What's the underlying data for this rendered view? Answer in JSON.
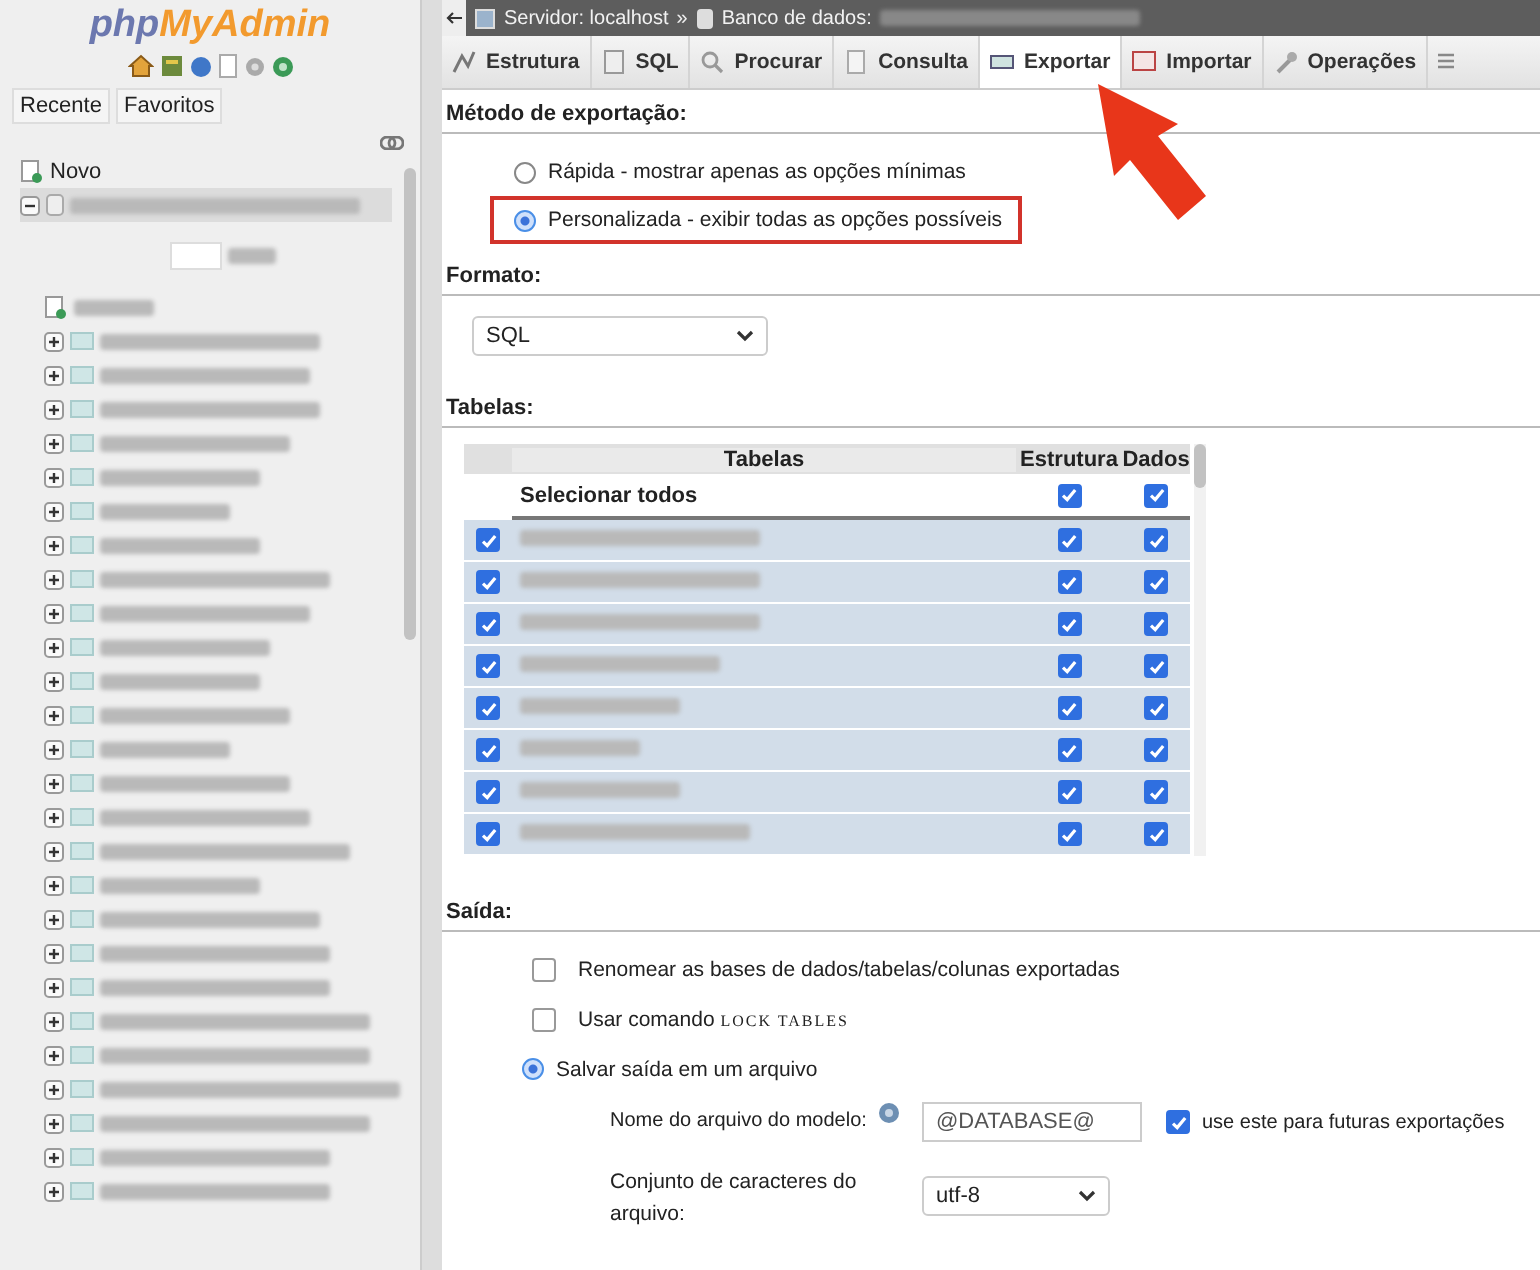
{
  "sidebar": {
    "logo": {
      "prefix": "php",
      "name": "MyAdmin"
    },
    "tabs": [
      {
        "label": "Recente"
      },
      {
        "label": "Favoritos"
      }
    ],
    "tree": [
      {
        "label": "Novo",
        "kind": "new"
      },
      {
        "kind": "database",
        "expanded": true,
        "selected": true,
        "children": [
          {
            "kind": "filter"
          },
          {
            "kind": "new"
          },
          {
            "kind": "table",
            "expanded": false
          },
          {
            "kind": "table",
            "expanded": false
          },
          {
            "kind": "table",
            "expanded": false
          },
          {
            "kind": "table",
            "expanded": false
          },
          {
            "kind": "table",
            "expanded": false
          },
          {
            "kind": "table",
            "expanded": false
          },
          {
            "kind": "table",
            "expanded": false
          },
          {
            "kind": "table",
            "expanded": false
          },
          {
            "kind": "table",
            "expanded": false
          },
          {
            "kind": "table",
            "expanded": false
          },
          {
            "kind": "table",
            "expanded": false
          },
          {
            "kind": "table",
            "expanded": false
          },
          {
            "kind": "table",
            "expanded": false
          },
          {
            "kind": "table",
            "expanded": false
          },
          {
            "kind": "table",
            "expanded": false
          },
          {
            "kind": "table",
            "expanded": false
          },
          {
            "kind": "table",
            "expanded": false
          },
          {
            "kind": "table",
            "expanded": false
          },
          {
            "kind": "table",
            "expanded": false
          },
          {
            "kind": "table",
            "expanded": false
          },
          {
            "kind": "table",
            "expanded": false
          },
          {
            "kind": "table",
            "expanded": false
          },
          {
            "kind": "table",
            "expanded": false
          },
          {
            "kind": "table",
            "expanded": false
          },
          {
            "kind": "table",
            "expanded": false
          },
          {
            "kind": "table",
            "expanded": false
          }
        ]
      }
    ]
  },
  "breadcrumb": {
    "server": "Servidor: localhost",
    "separator": "»",
    "database": "Banco de dados:"
  },
  "tabs": [
    {
      "label": "Estrutura",
      "selected": false
    },
    {
      "label": "SQL",
      "selected": false
    },
    {
      "label": "Procurar",
      "selected": false
    },
    {
      "label": "Consulta",
      "selected": false
    },
    {
      "label": "Exportar",
      "selected": true
    },
    {
      "label": "Importar",
      "selected": false
    },
    {
      "label": "Operações",
      "selected": false
    }
  ],
  "export_method": {
    "title": "Método de exportação:",
    "options": [
      {
        "label": "Rápida - mostrar apenas as opções mínimas",
        "selected": false,
        "highlighted": false
      },
      {
        "label": "Personalizada - exibir todas as opções possíveis",
        "selected": true,
        "highlighted": true
      }
    ]
  },
  "format": {
    "title": "Formato:",
    "value": "SQL"
  },
  "tables": {
    "title": "Tabelas:",
    "columns": [
      "Tabelas",
      "Estrutura",
      "Dados"
    ],
    "select_all": {
      "label": "Selecionar todos",
      "structure": true,
      "data": true
    },
    "rows": [
      {
        "selected": true,
        "structure": true,
        "data": true
      },
      {
        "selected": true,
        "structure": true,
        "data": true
      },
      {
        "selected": true,
        "structure": true,
        "data": true
      },
      {
        "selected": true,
        "structure": true,
        "data": true
      },
      {
        "selected": true,
        "structure": true,
        "data": true
      },
      {
        "selected": true,
        "structure": true,
        "data": true
      },
      {
        "selected": true,
        "structure": true,
        "data": true
      },
      {
        "selected": true,
        "structure": true,
        "data": true
      }
    ]
  },
  "output": {
    "title": "Saída:",
    "options": [
      {
        "kind": "checkbox",
        "label": "Renomear as bases de dados/tabelas/colunas exportadas",
        "checked": false
      },
      {
        "kind": "checkbox",
        "label": "Usar comando ",
        "code": "LOCK TABLES",
        "checked": false
      },
      {
        "kind": "radio",
        "label": "Salvar saída em um arquivo",
        "checked": true
      }
    ],
    "filename": {
      "label": "Nome do arquivo do modelo:",
      "value": "@DATABASE@",
      "remember": {
        "label": "use este para futuras exportações",
        "checked": true
      }
    },
    "charset": {
      "label": "Conjunto de caracteres do arquivo:",
      "value": "utf-8"
    }
  }
}
